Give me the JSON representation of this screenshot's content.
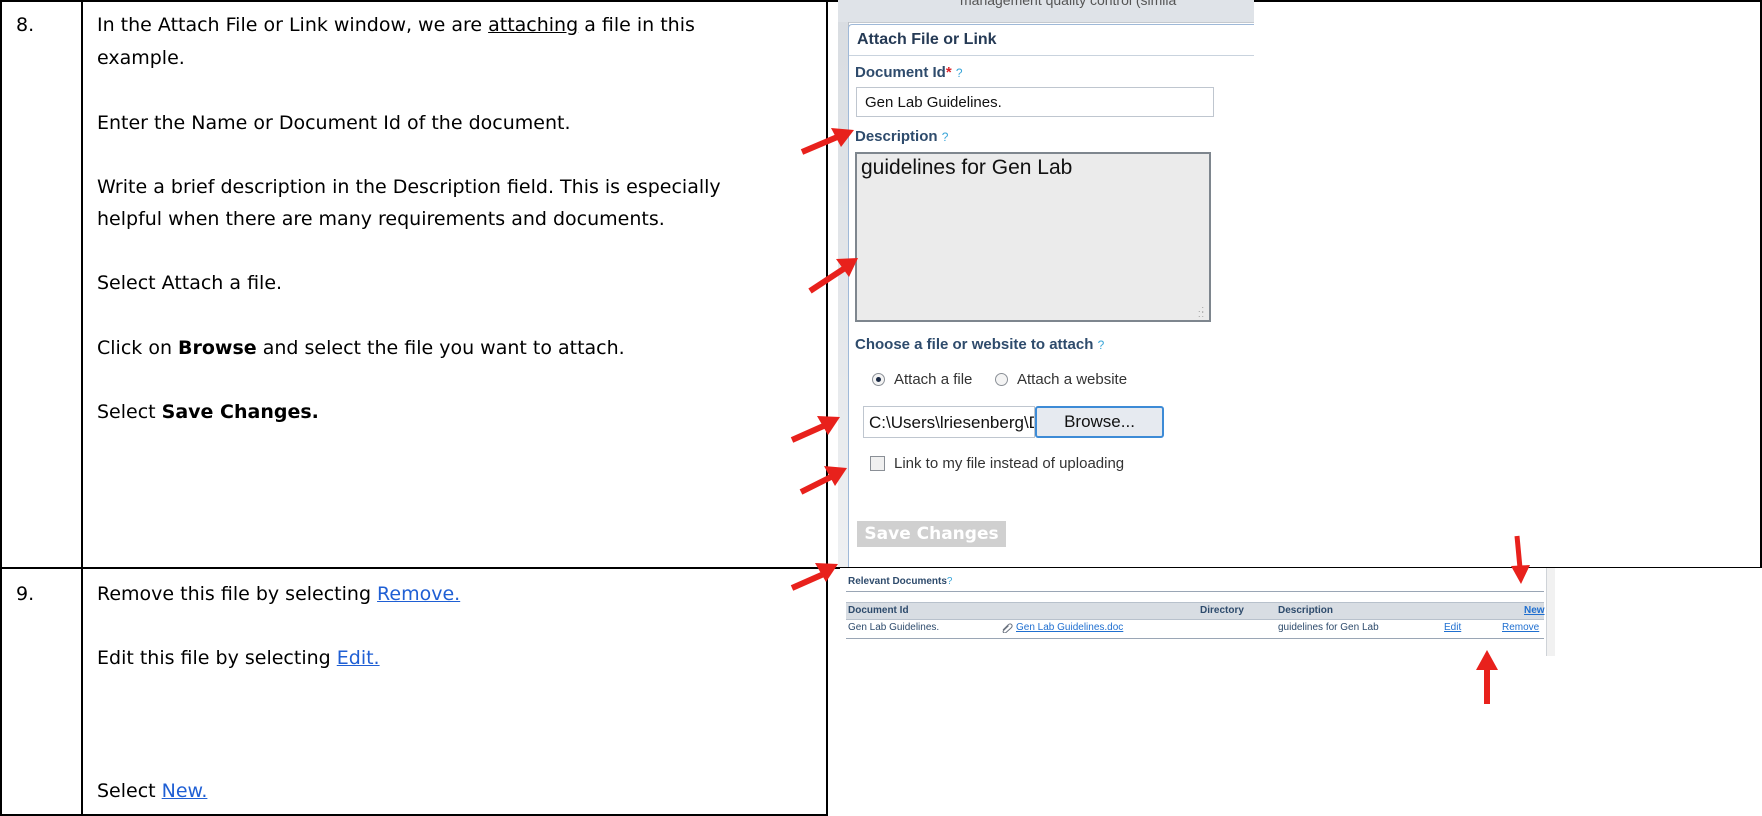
{
  "steps": [
    {
      "number": "8.",
      "lines": {
        "l1_pre": "In the Attach File or Link window, we are ",
        "l1_u": "attaching",
        "l1_post": " a file in this",
        "l2": "example.",
        "l3": "Enter the Name or Document Id of the document.",
        "l4": "Write a brief description in the Description field. This is especially",
        "l5": "helpful when there are many requirements and documents.",
        "l6": "Select Attach a file.",
        "l7_pre": "Click on ",
        "l7_b": "Browse",
        "l7_post": " and select the file you want to attach.",
        "l8_pre": "Select ",
        "l8_b": "Save Changes."
      }
    },
    {
      "number": "9.",
      "lines": {
        "l1_pre": "Remove this file by selecting ",
        "l1_link": "Remove.",
        "l2_pre": "Edit this file by selecting ",
        "l2_link": "Edit.",
        "l3_pre": "Select ",
        "l3_link": "New."
      }
    }
  ],
  "attach_window": {
    "top_partial_text": "management quality control (simila",
    "title": "Attach File or Link",
    "document_id_label": "Document Id",
    "required_mark": "*",
    "help_mark": "?",
    "document_id_value": "Gen Lab Guidelines.",
    "description_label": "Description",
    "description_value": "guidelines for Gen Lab",
    "choose_label": "Choose a file or website to attach",
    "options": [
      "Attach a file",
      "Attach a website"
    ],
    "selected_option": "Attach a file",
    "file_path": "C:\\Users\\lriesenberg\\D",
    "browse_label": "Browse...",
    "link_checkbox_label": "Link to my file instead of uploading",
    "save_button": "Save Changes"
  },
  "relevant_documents": {
    "title": "Relevant Documents",
    "help_mark": "?",
    "columns": [
      "Document Id",
      "Directory",
      "Description"
    ],
    "new_link": "New",
    "row": {
      "document_id": "Gen Lab Guidelines.",
      "file_link": "Gen Lab Guidelines.doc",
      "description": "guidelines for Gen Lab",
      "edit": "Edit",
      "remove": "Remove"
    }
  },
  "colors": {
    "arrow": "#e8211c",
    "link": "#1f5fd4",
    "label": "#2e4b6c"
  },
  "icons": [
    "paperclip-icon",
    "red-arrow-icon",
    "help-icon"
  ]
}
